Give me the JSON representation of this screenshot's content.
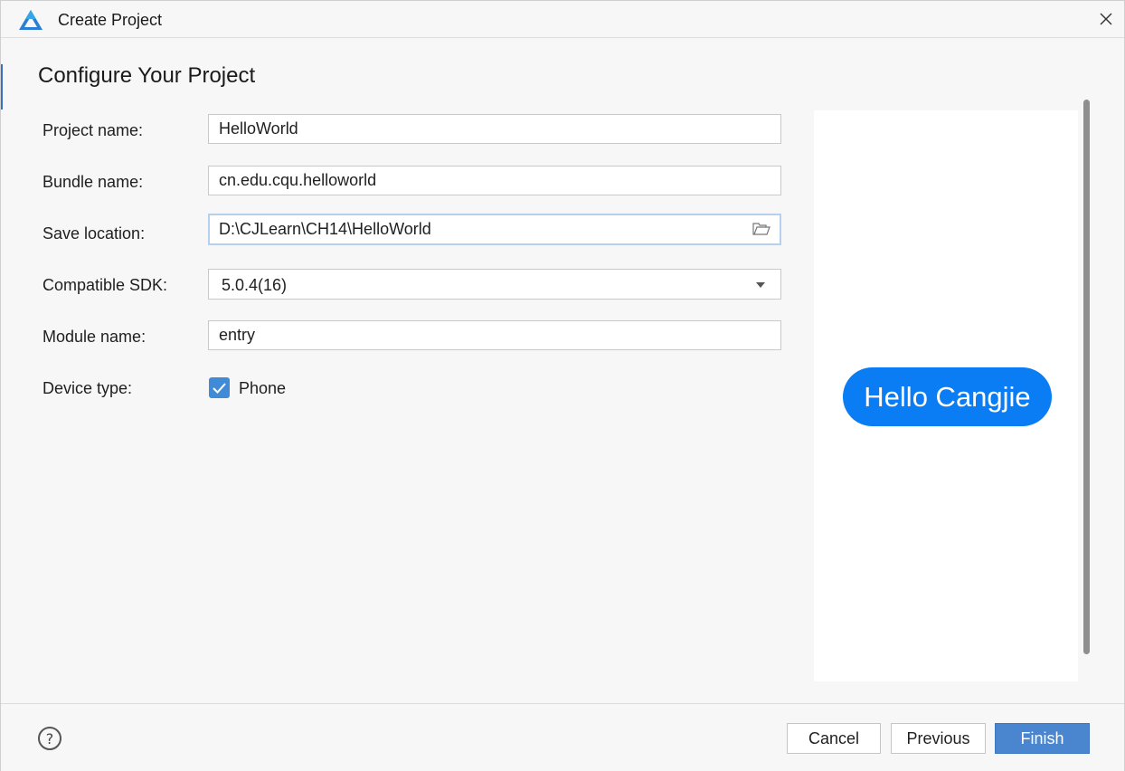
{
  "window": {
    "title": "Create Project",
    "logo_icon": "deveco-logo-icon",
    "close_icon": "close-icon"
  },
  "page": {
    "title": "Configure Your Project"
  },
  "form": {
    "project_name": {
      "label": "Project name:",
      "value": "HelloWorld"
    },
    "bundle_name": {
      "label": "Bundle name:",
      "value": "cn.edu.cqu.helloworld"
    },
    "save_location": {
      "label": "Save location:",
      "value": "D:\\CJLearn\\CH14\\HelloWorld",
      "icon": "folder-icon"
    },
    "compatible_sdk": {
      "label": "Compatible SDK:",
      "value": "5.0.4(16)"
    },
    "module_name": {
      "label": "Module name:",
      "value": "entry"
    },
    "device_type": {
      "label": "Device type:",
      "option_label": "Phone",
      "checked": true
    }
  },
  "preview": {
    "button_text": "Hello Cangjie",
    "button_color": "#0a7df5"
  },
  "footer": {
    "help_icon": "help-icon",
    "help_glyph": "?",
    "cancel_label": "Cancel",
    "previous_label": "Previous",
    "finish_label": "Finish"
  },
  "colors": {
    "accent": "#4a86d0",
    "checkbox": "#3f8bd8"
  }
}
